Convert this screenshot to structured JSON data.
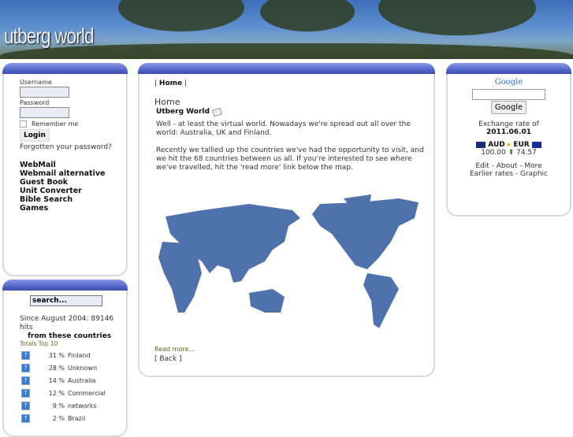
{
  "site": {
    "logo": "utberg world"
  },
  "login": {
    "username_label": "Username",
    "password_label": "Password",
    "username_value": "",
    "password_value": "",
    "remember_label": "Remember me",
    "login_button": "Login",
    "forgot": "Forgotten your password?"
  },
  "nav": [
    "WebMail",
    "Webmail alternative",
    "Guest Book",
    "Unit Converter",
    "Bible Search",
    "Games"
  ],
  "stats": {
    "search_placeholder": "search...",
    "since": "Since August 2004:  89146 hits",
    "from": "from these countries",
    "totals": "Totals Top 10",
    "countries": [
      {
        "pct": "31 %",
        "name": "Finland"
      },
      {
        "pct": "28 %",
        "name": "Unknown"
      },
      {
        "pct": "14 %",
        "name": "Australia"
      },
      {
        "pct": "12 %",
        "name": "Commercial"
      },
      {
        "pct": "9 %",
        "name": "networks"
      },
      {
        "pct": "2 %",
        "name": "Brazil"
      }
    ]
  },
  "main": {
    "breadcrumb_pre": "|",
    "breadcrumb": "Home",
    "breadcrumb_post": "|",
    "heading": "Home",
    "article_title": "Utberg World",
    "p1": "Well - at least the virtual world. Nowadays we're spread out all over the world: Australia, UK and Finland.",
    "p2": "Recently we tallied up the countries we've had the opportunity to visit, and we hit the 68 countries between us all.  If you're interested to see where we've travelled, hit the 'read more' link below the map.",
    "read_more": "Read more...",
    "back": "[ Back ]"
  },
  "right": {
    "google_logo": "Google",
    "search_value": "",
    "google_button": "Google",
    "rate_label": "Exchange rate of",
    "rate_date": "2011.06.01",
    "from_cur": "AUD",
    "to_cur": "EUR",
    "from_amt": "100.00",
    "to_amt": "74.57",
    "links1": [
      "Edit",
      "About",
      "More"
    ],
    "links2": [
      "Earlier rates",
      "Graphic"
    ]
  }
}
